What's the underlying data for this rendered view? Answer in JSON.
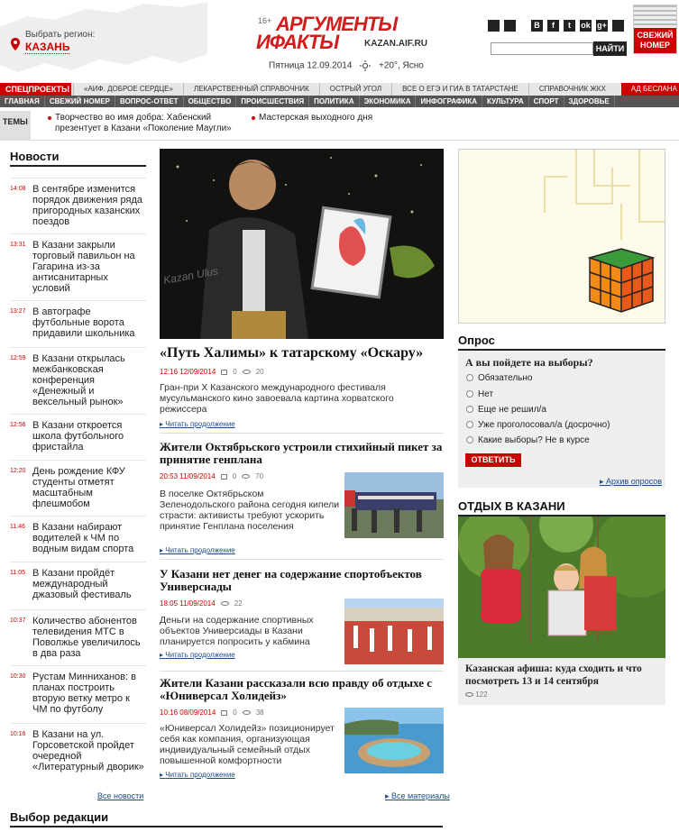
{
  "header": {
    "region_caption": "Выбрать регион:",
    "region_city": "КАЗАНЬ",
    "logo_age": "16+",
    "logo_line1": "АРГУМЕНТЫ",
    "logo_line2": "ИФАКТЫ",
    "logo_domain": "KAZAN.AIF.RU",
    "date": "Пятница 12.09.2014",
    "weather": "+20°, Ясно",
    "search_button": "НАЙТИ",
    "social": [
      {
        "icon": "apple-icon",
        "label": ""
      },
      {
        "icon": "android-icon",
        "label": ""
      },
      {
        "icon": "vk-icon",
        "label": "В"
      },
      {
        "icon": "facebook-icon",
        "label": "f"
      },
      {
        "icon": "twitter-icon",
        "label": "t"
      },
      {
        "icon": "odnoklassniki-icon",
        "label": "ok"
      },
      {
        "icon": "googleplus-icon",
        "label": "g+"
      },
      {
        "icon": "rss-icon",
        "label": ""
      }
    ],
    "fresh_issue_line1": "СВЕЖИЙ",
    "fresh_issue_line2": "НОМЕР"
  },
  "special": {
    "label": "СПЕЦПРОЕКТЫ",
    "items": [
      "«АИФ. ДОБРОЕ СЕРДЦЕ»",
      "ЛЕКАРСТВЕННЫЙ СПРАВОЧНИК",
      "ОСТРЫЙ УГОЛ",
      "ВСЕ О ЕГЭ И ГИА В ТАТАРСТАНЕ",
      "СПРАВОЧНИК ЖКХ"
    ],
    "hot": "АД БЕСЛАНА"
  },
  "nav": [
    "ГЛАВНАЯ",
    "СВЕЖИЙ НОМЕР",
    "ВОПРОС-ОТВЕТ",
    "ОБЩЕСТВО",
    "ПРОИСШЕСТВИЯ",
    "ПОЛИТИКА",
    "ЭКОНОМИКА",
    "ИНФОГРАФИКА",
    "КУЛЬТУРА",
    "СПОРТ",
    "ЗДОРОВЬЕ"
  ],
  "topics": {
    "label": "ТЕМЫ",
    "items": [
      {
        "line1": "Творчество во имя добра: Хабенский",
        "line2": "презентует в Казани «Поколение Маугли»"
      },
      {
        "line1": "Мастерская выходного дня",
        "line2": ""
      }
    ]
  },
  "news": {
    "title": "Новости",
    "items": [
      {
        "time": "14:08",
        "text": "В сентябре изменится порядок движения ряда пригородных казанских поездов"
      },
      {
        "time": "13:31",
        "text": "В Казани закрыли торговый павильон на Гагарина из-за антисанитарных условий"
      },
      {
        "time": "13:27",
        "text": "В автографе футбольные ворота придавили школьника"
      },
      {
        "time": "12:59",
        "text": "В Казани открылась межбанковская конференция «Денежный и вексельный рынок»"
      },
      {
        "time": "12:56",
        "text": "В Казани откроется школа футбольного фристайла"
      },
      {
        "time": "12:20",
        "text": "День рождение КФУ студенты отметят масштабным флешмобом"
      },
      {
        "time": "11:46",
        "text": "В Казани набирают водителей к ЧМ по водным видам спорта"
      },
      {
        "time": "11:05",
        "text": "В Казани пройдёт международный джазовый фестиваль"
      },
      {
        "time": "10:37",
        "text": "Количество абонентов телевидения МТС в Поволжье увеличилось в два раза"
      },
      {
        "time": "10:30",
        "text": "Рустам Минниханов: в планах построить вторую ветку метро к ЧМ по футболу"
      },
      {
        "time": "10:16",
        "text": "В Казани на ул. Горсоветской пройдет очередной «Литературный дворик»"
      }
    ],
    "all_link": "Все новости"
  },
  "main": {
    "hero": {
      "title": "«Путь Халимы» к татарскому «Оскару»",
      "time": "12:16 12/09/2014",
      "comments": "0",
      "views": "20",
      "lead": "Гран-при X Казанского международного фестиваля мусульманского кино завоевала картина хорватского режиссера",
      "more": "Читать продолжение",
      "image_caption": "Kazan Ulus"
    },
    "articles": [
      {
        "title": "Жители Октябрьского устроили стихийный пикет за принятие генплана",
        "time": "20:53 11/09/2014",
        "comments": "0",
        "views": "70",
        "lead": "В поселке Октябрьском Зеленодольского района сегодня кипели страсти: активисты требуют ускорить принятие Генплана поселения",
        "more": "Читать продолжение"
      },
      {
        "title": "У Казани нет денег на содержание спортобъектов Универсиады",
        "time": "18:05 11/09/2014",
        "comments": "",
        "views": "22",
        "lead": "Деньги на содержание спортивных объектов Универсиады в Казани планируется попросить у кабмина",
        "more": "Читать продолжение"
      },
      {
        "title": "Жители Казани рассказали всю правду об отдыхе с «Юниверсал Холидейз»",
        "time": "10:16 08/09/2014",
        "comments": "0",
        "views": "38",
        "lead": "«Юниверсал Холидейз» позиционирует себя как компания, организующая индивидуальный семейный отдых повышенной комфортности",
        "more": "Читать продолжение"
      }
    ],
    "all_link": "Все материалы"
  },
  "poll": {
    "title": "Опрос",
    "question": "А вы пойдете на выборы?",
    "options": [
      "Обязательно",
      "Нет",
      "Еще не решил/а",
      "Уже проголосовал/а (досрочно)",
      "Какие выборы? Не в курсе"
    ],
    "vote": "ОТВЕТИТЬ",
    "archive": "Архив опросов"
  },
  "rest": {
    "title": "ОТДЫХ В КАЗАНИ",
    "text": "Казанская афиша: куда сходить и что посмотреть 13 и 14 сентября",
    "views": "122"
  },
  "editor": {
    "title": "Выбор редакции"
  },
  "colors": {
    "brand": "#d31c1c",
    "nav": "#555555",
    "link": "#1a4b8c"
  }
}
